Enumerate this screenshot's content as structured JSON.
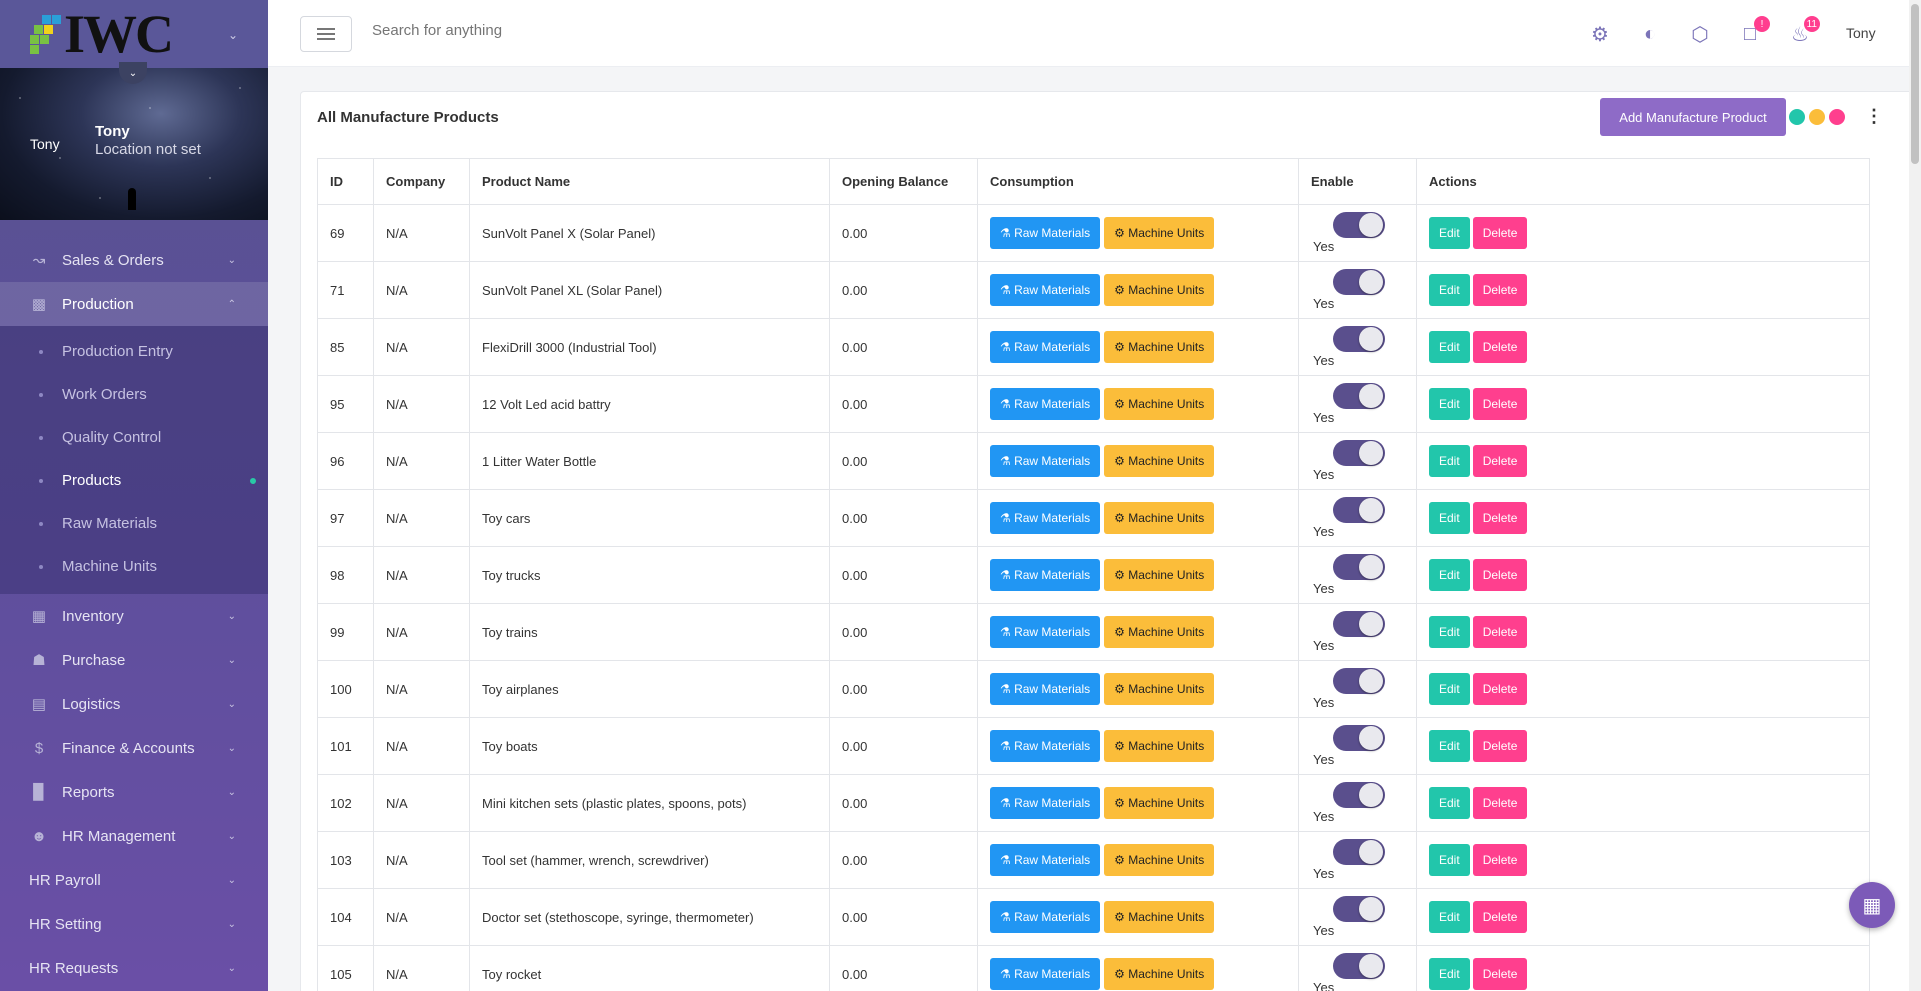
{
  "brand": {
    "logo_text": "IWC"
  },
  "profile": {
    "short_name": "Tony",
    "name": "Tony",
    "location": "Location not set"
  },
  "nav": {
    "items_top": [
      {
        "label": "Sales & Orders",
        "icon": "chart-line-icon"
      },
      {
        "label": "Production",
        "icon": "factory-icon"
      }
    ],
    "production_sub": [
      {
        "label": "Production Entry"
      },
      {
        "label": "Work Orders"
      },
      {
        "label": "Quality Control"
      },
      {
        "label": "Products"
      },
      {
        "label": "Raw Materials"
      },
      {
        "label": "Machine Units"
      }
    ],
    "items_bottom": [
      {
        "label": "Inventory",
        "icon": "warehouse-icon"
      },
      {
        "label": "Purchase",
        "icon": "cart-icon"
      },
      {
        "label": "Logistics",
        "icon": "truck-icon"
      },
      {
        "label": "Finance & Accounts",
        "icon": "dollar-icon"
      },
      {
        "label": "Reports",
        "icon": "bar-chart-icon"
      },
      {
        "label": "HR Management",
        "icon": "users-cog-icon"
      },
      {
        "label": "HR Payroll"
      },
      {
        "label": "HR Setting"
      },
      {
        "label": "HR Requests"
      }
    ]
  },
  "topbar": {
    "search_placeholder": "Search for anything",
    "messages_badge": "!",
    "notifications_badge": "11",
    "user": "Tony"
  },
  "card": {
    "title": "All Manufacture Products",
    "add_button": "Add Manufacture Product",
    "color_dots": [
      "#22c6ab",
      "#fbbd3a",
      "#ff3f8e"
    ]
  },
  "table": {
    "headers": [
      "ID",
      "Company",
      "Product Name",
      "Opening Balance",
      "Consumption",
      "Enable",
      "Actions"
    ],
    "raw_label": "Raw Materials",
    "machine_label": "Machine Units",
    "edit_label": "Edit",
    "delete_label": "Delete",
    "rows": [
      {
        "id": "69",
        "company": "N/A",
        "product": "SunVolt Panel X (Solar Panel)",
        "balance": "0.00",
        "enabled": "Yes"
      },
      {
        "id": "71",
        "company": "N/A",
        "product": "SunVolt Panel XL (Solar Panel)",
        "balance": "0.00",
        "enabled": "Yes"
      },
      {
        "id": "85",
        "company": "N/A",
        "product": "FlexiDrill 3000 (Industrial Tool)",
        "balance": "0.00",
        "enabled": "Yes"
      },
      {
        "id": "95",
        "company": "N/A",
        "product": "12 Volt Led acid battry",
        "balance": "0.00",
        "enabled": "Yes"
      },
      {
        "id": "96",
        "company": "N/A",
        "product": "1 Litter Water Bottle",
        "balance": "0.00",
        "enabled": "Yes"
      },
      {
        "id": "97",
        "company": "N/A",
        "product": "Toy cars",
        "balance": "0.00",
        "enabled": "Yes"
      },
      {
        "id": "98",
        "company": "N/A",
        "product": "Toy trucks",
        "balance": "0.00",
        "enabled": "Yes"
      },
      {
        "id": "99",
        "company": "N/A",
        "product": "Toy trains",
        "balance": "0.00",
        "enabled": "Yes"
      },
      {
        "id": "100",
        "company": "N/A",
        "product": "Toy airplanes",
        "balance": "0.00",
        "enabled": "Yes"
      },
      {
        "id": "101",
        "company": "N/A",
        "product": "Toy boats",
        "balance": "0.00",
        "enabled": "Yes"
      },
      {
        "id": "102",
        "company": "N/A",
        "product": "Mini kitchen sets (plastic plates, spoons, pots)",
        "balance": "0.00",
        "enabled": "Yes"
      },
      {
        "id": "103",
        "company": "N/A",
        "product": "Tool set (hammer, wrench, screwdriver)",
        "balance": "0.00",
        "enabled": "Yes"
      },
      {
        "id": "104",
        "company": "N/A",
        "product": "Doctor set (stethoscope, syringe, thermometer)",
        "balance": "0.00",
        "enabled": "Yes"
      },
      {
        "id": "105",
        "company": "N/A",
        "product": "Toy rocket",
        "balance": "0.00",
        "enabled": "Yes"
      }
    ]
  }
}
